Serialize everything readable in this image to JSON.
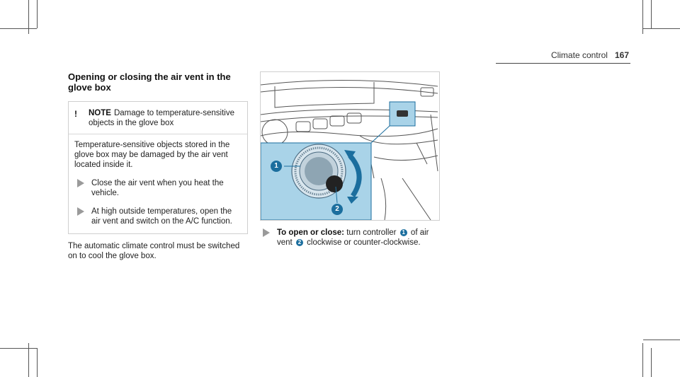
{
  "header": {
    "section": "Climate control",
    "page_number": "167"
  },
  "left": {
    "title": "Opening or closing the air vent in the glove box",
    "note": {
      "label": "NOTE",
      "heading": "Damage to temperature-sensitive objects in the glove box",
      "body": "Temperature-sensitive objects stored in the glove box may be damaged by the air vent located inside it.",
      "steps": [
        "Close the air vent when you heat the vehicle.",
        "At high outside temperatures, open the air vent and switch on the A/C function."
      ]
    },
    "paragraph": "The automatic climate control must be switched on to cool the glove box."
  },
  "figure": {
    "callouts": [
      "1",
      "2"
    ],
    "colors": {
      "highlight": "#a9d3e8",
      "accent": "#1b6e9e"
    },
    "icons": [
      "warning-icon",
      "step-arrow-icon",
      "rotate-arrow-icon"
    ]
  },
  "instruction": {
    "lead": "To open or close:",
    "text_a": "turn controller",
    "ref1": "1",
    "text_b": "of air vent",
    "ref2": "2",
    "text_c": "clockwise or counter-clockwise."
  }
}
